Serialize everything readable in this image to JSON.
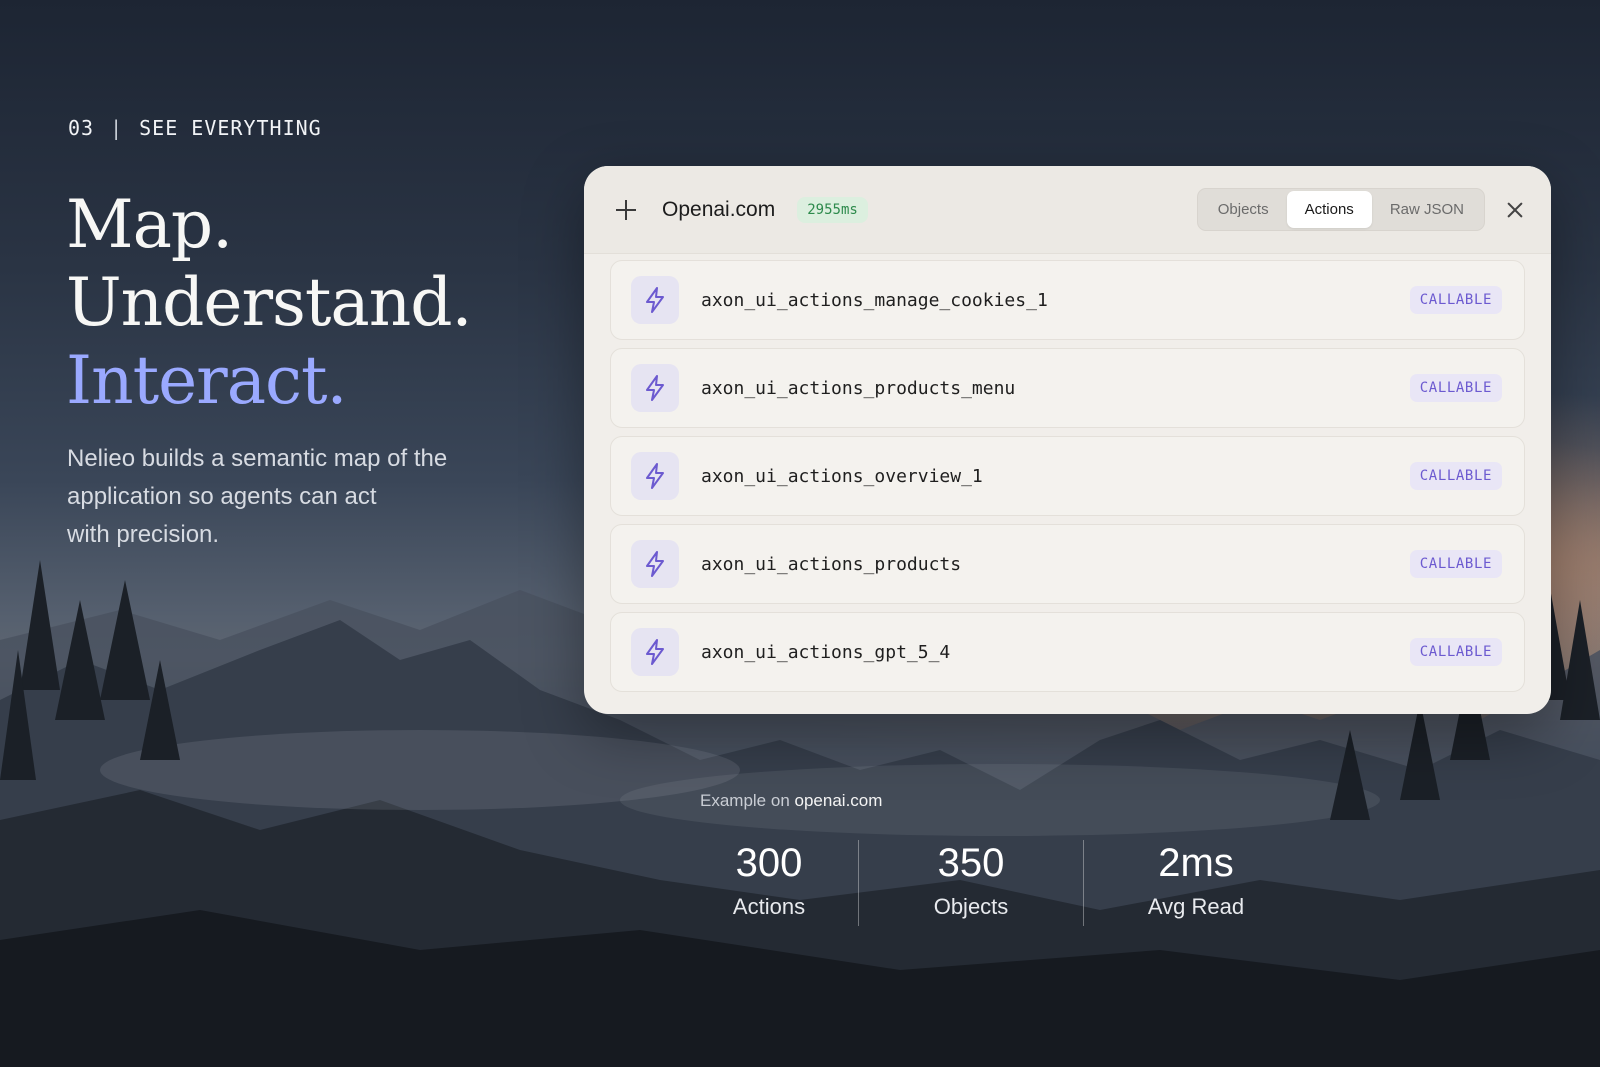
{
  "hero": {
    "eyebrow_number": "03",
    "eyebrow_separator": "|",
    "eyebrow_label": "SEE EVERYTHING",
    "headline_line1": "Map.",
    "headline_line2": "Understand.",
    "headline_line3": "Interact.",
    "blurb_line1": "Nelieo builds a semantic map of the",
    "blurb_line2": "application so agents can act",
    "blurb_line3": "with precision."
  },
  "panel": {
    "add_icon": "plus-icon",
    "site_title": "Openai.com",
    "latency": "2955ms",
    "tabs": [
      {
        "label": "Objects",
        "active": false
      },
      {
        "label": "Actions",
        "active": true
      },
      {
        "label": "Raw JSON",
        "active": false
      }
    ],
    "close_icon": "close-icon",
    "actions": [
      {
        "name": "axon_ui_actions_manage_cookies_1",
        "badge": "CALLABLE",
        "icon": "lightning-icon"
      },
      {
        "name": "axon_ui_actions_products_menu",
        "badge": "CALLABLE",
        "icon": "lightning-icon"
      },
      {
        "name": "axon_ui_actions_overview_1",
        "badge": "CALLABLE",
        "icon": "lightning-icon"
      },
      {
        "name": "axon_ui_actions_products",
        "badge": "CALLABLE",
        "icon": "lightning-icon"
      },
      {
        "name": "axon_ui_actions_gpt_5_4",
        "badge": "CALLABLE",
        "icon": "lightning-icon"
      }
    ]
  },
  "example": {
    "prefix": "Example on",
    "site": "openai.com"
  },
  "stats": [
    {
      "value": "300",
      "label": "Actions"
    },
    {
      "value": "350",
      "label": "Objects"
    },
    {
      "value": "2ms",
      "label": "Avg Read"
    }
  ],
  "colors": {
    "accent_headline": "#9aa9ff",
    "badge_text": "#6c5ad0",
    "latency_text": "#2d8a4c",
    "panel_bg": "#f1eeea"
  }
}
